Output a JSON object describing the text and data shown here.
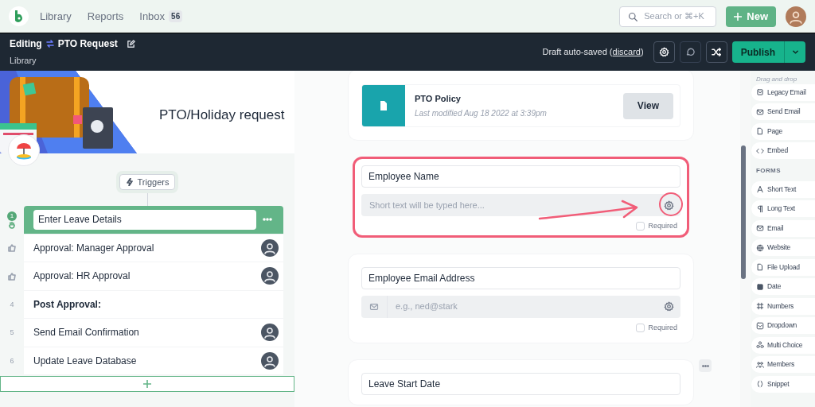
{
  "top_nav": {
    "links": [
      {
        "label": "Library"
      },
      {
        "label": "Reports"
      },
      {
        "label": "Inbox",
        "badge": "56"
      }
    ],
    "search": {
      "placeholder": "Search or ⌘+K"
    },
    "new_button": "New"
  },
  "editor_bar": {
    "mode": "Editing",
    "title": "PTO Request",
    "breadcrumb": "Library",
    "draft_prefix": "Draft auto-saved (",
    "discard_link": "discard",
    "draft_suffix": ")",
    "publish_button": "Publish"
  },
  "template": {
    "title": "PTO/Holiday request",
    "triggers_button": "Triggers",
    "steps": [
      {
        "number": "1",
        "label": "Enter Leave Details",
        "kind": "form",
        "selected": true,
        "assigned": false
      },
      {
        "label": "Approval: Manager Approval",
        "kind": "approval",
        "selected": false,
        "assigned": true
      },
      {
        "label": "Approval: HR Approval",
        "kind": "approval",
        "selected": false,
        "assigned": true
      },
      {
        "number": "4",
        "label": "Post Approval:",
        "kind": "heading",
        "selected": false,
        "assigned": false
      },
      {
        "number": "5",
        "label": "Send Email Confirmation",
        "kind": "task",
        "selected": false,
        "assigned": true
      },
      {
        "number": "6",
        "label": "Update Leave Database",
        "kind": "task",
        "selected": false,
        "assigned": true
      }
    ]
  },
  "form": {
    "attachment": {
      "name": "PTO Policy",
      "modified": "Last modified Aug 18 2022 at 3:39pm",
      "button": "View"
    },
    "fields": [
      {
        "label": "Employee Name",
        "kind": "short_text",
        "placeholder": "Short text will be typed here...",
        "required": false,
        "required_label": "Required",
        "highlighted": true,
        "menu_shown": false
      },
      {
        "label": "Employee Email Address",
        "kind": "email",
        "placeholder": "e.g., ned@stark",
        "required": false,
        "required_label": "Required",
        "highlighted": false,
        "menu_shown": false
      },
      {
        "label": "Leave Start Date",
        "highlighted": false,
        "menu_shown": true
      }
    ]
  },
  "sidebar": {
    "hint": "Drag and drop",
    "sections": [
      {
        "items": [
          {
            "label": "Legacy Email",
            "kind": "legacy_email"
          },
          {
            "label": "Send Email",
            "kind": "email"
          },
          {
            "label": "Page",
            "kind": "page"
          },
          {
            "label": "Embed",
            "kind": "embed"
          }
        ]
      },
      {
        "heading": "FORMS",
        "items": [
          {
            "label": "Short Text",
            "kind": "short_text"
          },
          {
            "label": "Long Text",
            "kind": "long_text"
          },
          {
            "label": "Email",
            "kind": "email"
          },
          {
            "label": "Website",
            "kind": "website"
          },
          {
            "label": "File Upload",
            "kind": "file"
          },
          {
            "label": "Date",
            "kind": "date"
          },
          {
            "label": "Numbers",
            "kind": "numbers"
          },
          {
            "label": "Dropdown",
            "kind": "dropdown"
          },
          {
            "label": "Multi Choice",
            "kind": "multi_choice"
          },
          {
            "label": "Members",
            "kind": "members"
          },
          {
            "label": "Snippet",
            "kind": "snippet"
          }
        ]
      }
    ]
  }
}
